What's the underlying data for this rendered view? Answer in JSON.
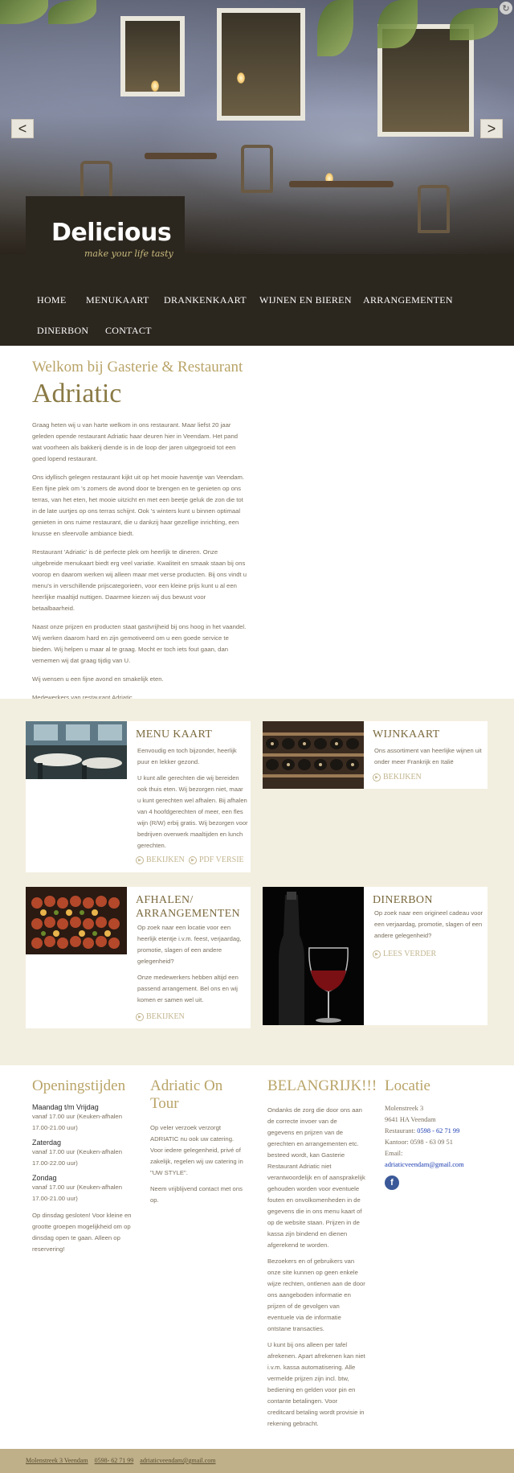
{
  "hero": {
    "prev_label": "<",
    "next_label": ">"
  },
  "logo": {
    "name": "Delicious",
    "tagline": "make your life tasty"
  },
  "nav": {
    "items": [
      "HOME",
      "MENUKAART",
      "DRANKENKAART",
      "WIJNEN EN BIEREN",
      "ARRANGEMENTEN",
      "DINERBON",
      "CONTACT"
    ]
  },
  "welcome": {
    "subtitle": "Welkom bij Gasterie & Restaurant",
    "title": "Adriatic",
    "paragraphs": [
      "Graag heten wij u van harte welkom in ons restaurant. Maar liefst 20 jaar geleden opende restaurant Adriatic haar deuren hier in Veendam. Het pand wat voorheen als bakkerij diende is in de loop der jaren uitgegroeid tot een goed lopend restaurant.",
      "Ons idyllisch gelegen restaurant kijkt uit op het mooie haventje van Veendam. Een fijne plek om 's zomers de avond door te brengen en te genieten op ons terras, van het eten, het mooie uitzicht en met een beetje geluk de zon die tot in de late uurtjes op ons terras schijnt. Ook 's winters kunt u binnen optimaal genieten in ons ruime restaurant, die u dankzij haar gezellige inrichting, een knusse en sfeervolle ambiance biedt.",
      "Restaurant 'Adriatic' is dé perfecte plek om heerlijk te dineren. Onze uitgebreide menukaart biedt erg veel variatie. Kwaliteit en smaak staan bij ons voorop en daarom werken wij alleen maar met verse producten. Bij ons vindt u menu's in verschillende prijscategorieën, voor een kleine prijs kunt u al een heerlijke maaltijd nuttigen. Daarmee kiezen wij dus bewust voor betaalbaarheid.",
      "Naast onze prijzen en producten staat gastvrijheid bij ons hoog in het vaandel. Wij werken daarom hard en zijn gemotiveerd om u een goede service te bieden. Wij helpen u maar al te graag. Mocht er toch iets fout gaan, dan vernemen wij dat graag tijdig van U.",
      "Wij wensen u een fijne avond en smakelijk eten.",
      "Medewerkers van restaurant Adriatic"
    ]
  },
  "cards": {
    "menu": {
      "title": "MENU KAART",
      "body": [
        "Eenvoudig en toch bijzonder, heerlijk puur en lekker gezond.",
        "U kunt alle gerechten die wij bereiden ook thuis eten. Wij bezorgen niet, maar u kunt gerechten wel afhalen. Bij afhalen van 4 hoofdgerechten of meer, een fles wijn (R/W) erbij gratis. Wij bezorgen voor bedrijven overwerk maaltijden en lunch gerechten."
      ],
      "link1": "BEKIJKEN",
      "link2": "PDF VERSIE"
    },
    "wijn": {
      "title": "WIJNKAART",
      "body": [
        "Ons assortiment van heerlijke wijnen uit onder meer Frankrijk en Italië"
      ],
      "link1": "BEKIJKEN"
    },
    "afhalen": {
      "title": "AFHALEN/ ARRANGEMENTEN",
      "body": [
        "Op zoek naar een locatie voor een heerlijk etentje i.v.m. feest, verjaardag, promotie, slagen of een andere gelegenheid?",
        "Onze medewerkers hebben altijd een passend arrangement. Bel ons en wij komen er samen wel uit."
      ],
      "link1": "BEKIJKEN"
    },
    "dinerbon": {
      "title": "DINERBON",
      "body": [
        "Op zoek naar een origineel cadeau voor een verjaardag, promotie, slagen of een andere gelegenheid?"
      ],
      "link1": "LEES VERDER"
    }
  },
  "hours": {
    "title": "Openingstijden",
    "days": [
      {
        "day": "Maandag t/m Vrijdag",
        "time": "vanaf 17.00 uur (Keuken-afhalen 17.00-21.00 uur)"
      },
      {
        "day": "Zaterdag",
        "time": "vanaf 17.00 uur (Keuken-afhalen 17.00-22.00 uur)"
      },
      {
        "day": "Zondag",
        "time": "vanaf 17.00 uur (Keuken-afhalen 17.00-21.00 uur)"
      }
    ],
    "note": "Op dinsdag gesloten! Voor kleine en grootte groepen mogelijkheid om op dinsdag open te gaan. Alleen op reservering!"
  },
  "tour": {
    "title": "Adriatic On Tour",
    "paragraphs": [
      "Op veler verzoek verzorgt ADRIATIC nu ook uw catering. Voor iedere gelegenheid, privé of zakelijk, regelen wij uw catering in \"UW STYLE\".",
      "Neem vrijblijvend contact met ons op."
    ]
  },
  "important": {
    "title": "BELANGRIJK!!!",
    "paragraphs": [
      "Ondanks de zorg die door ons aan de correcte invoer van de gegevens en prijzen van de gerechten en arrangementen etc. besteed wordt, kan Gasterie Restaurant Adriatic niet verantwoordelijk en of aansprakelijk gehouden worden voor eventuele fouten en onvolkomenheden in de gegevens die in ons menu kaart of op de website staan. Prijzen in de kassa zijn bindend en dienen afgerekend te worden.",
      "Bezoekers en of gebruikers van onze site kunnen op geen enkele wijze rechten, ontlenen aan de door ons aangeboden informatie en prijzen of de gevolgen van eventuele via de informatie ontstane transacties.",
      "U kunt bij ons alleen per tafel afrekenen. Apart afrekenen kan niet i.v.m. kassa automatisering. Alle vermelde prijzen zijn incl. btw, bediening en gelden voor pin en contante betalingen. Voor creditcard betaling wordt provisie in rekening gebracht."
    ]
  },
  "location": {
    "title": "Locatie",
    "street": "Molenstreek 3",
    "city": "9641 HA Veendam",
    "restaurant_label": "Restaurant:",
    "restaurant_phone": "0598 - 62 71 99",
    "office": "Kantoor: 0598 - 63 09 51",
    "email_label": "Email:",
    "email": "adriaticveendam@gmail.com",
    "facebook": "f"
  },
  "footer": {
    "address": "Molenstreek 3 Veendam",
    "phone": "0598- 62 71 99",
    "email": "adriaticveendam@gmail.com"
  },
  "colors": {
    "dark_bar": "#2b261e",
    "gold": "#b9a468",
    "cream_section": "#f3efe0",
    "footer": "#bfb08a"
  }
}
